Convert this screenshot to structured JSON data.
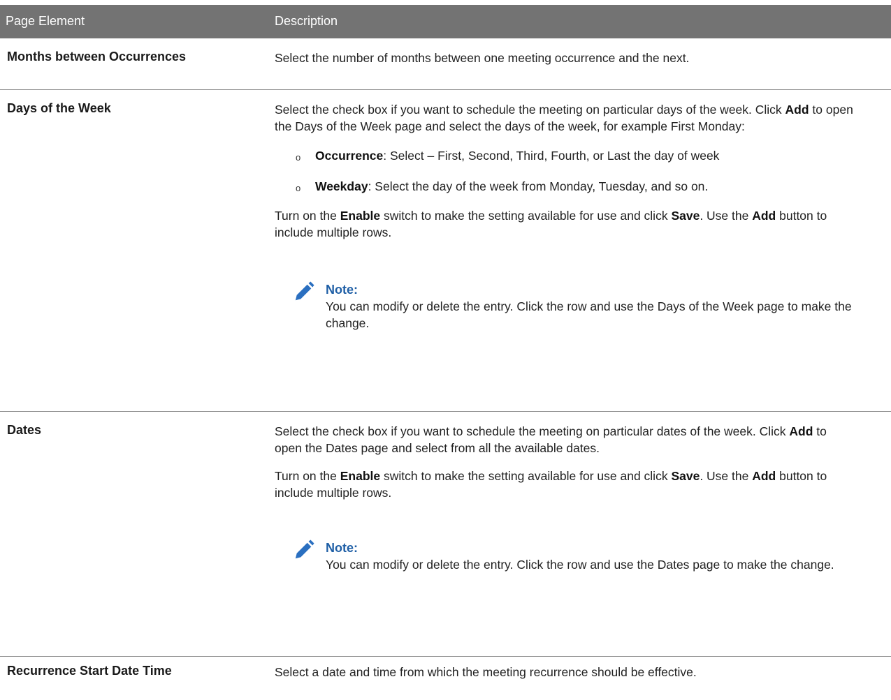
{
  "header": {
    "col1": "Page Element",
    "col2": "Description"
  },
  "rows": {
    "months": {
      "term": "Months between Occurrences",
      "desc": "Select the number of months between one meeting occurrence and the next."
    },
    "days": {
      "term": "Days of the Week",
      "intro_1": "Select the check box if you want to schedule the meeting on particular days of the week. Click ",
      "intro_add": "Add",
      "intro_2": " to open the Days of the Week page and select the days of the week, for example First Monday:",
      "bullets": [
        {
          "bold": "Occurrence",
          "text": ": Select – First, Second, Third, Fourth, or Last the day of week"
        },
        {
          "bold": "Weekday",
          "text": ": Select the day of the week from Monday, Tuesday, and so on."
        }
      ],
      "enable_1": "Turn on the ",
      "enable_bold": "Enable",
      "enable_2": " switch to make the setting available for use and click ",
      "save_bold": "Save",
      "enable_3": ". Use the ",
      "add_bold": "Add",
      "enable_4": " button to include multiple rows.",
      "note_title": "Note:",
      "note_body": "You can modify or delete the entry. Click the row and use the Days of the Week page to make the change."
    },
    "dates": {
      "term": "Dates",
      "intro_1": "Select the check box if you want to schedule the meeting on particular dates of the week. Click ",
      "intro_add": "Add",
      "intro_2": " to open the Dates page and select from all the available dates.",
      "enable_1": "Turn on the ",
      "enable_bold": "Enable",
      "enable_2": " switch to make the setting available for use and click ",
      "save_bold": "Save",
      "enable_3": ". Use the ",
      "add_bold": "Add",
      "enable_4": " button to include multiple rows.",
      "note_title": "Note:",
      "note_body": "You can modify or delete the entry. Click the row and use the Dates page to make the change."
    },
    "recurrence": {
      "term": "Recurrence Start Date Time",
      "desc": "Select a date and time from which the meeting recurrence should be effective."
    }
  },
  "colors": {
    "header_bg": "#737373",
    "note_title": "#1f5fa6",
    "pencil": "#2a6fc0"
  },
  "icons": {
    "note": "pencil-icon",
    "bullet": "circle-bullet"
  }
}
